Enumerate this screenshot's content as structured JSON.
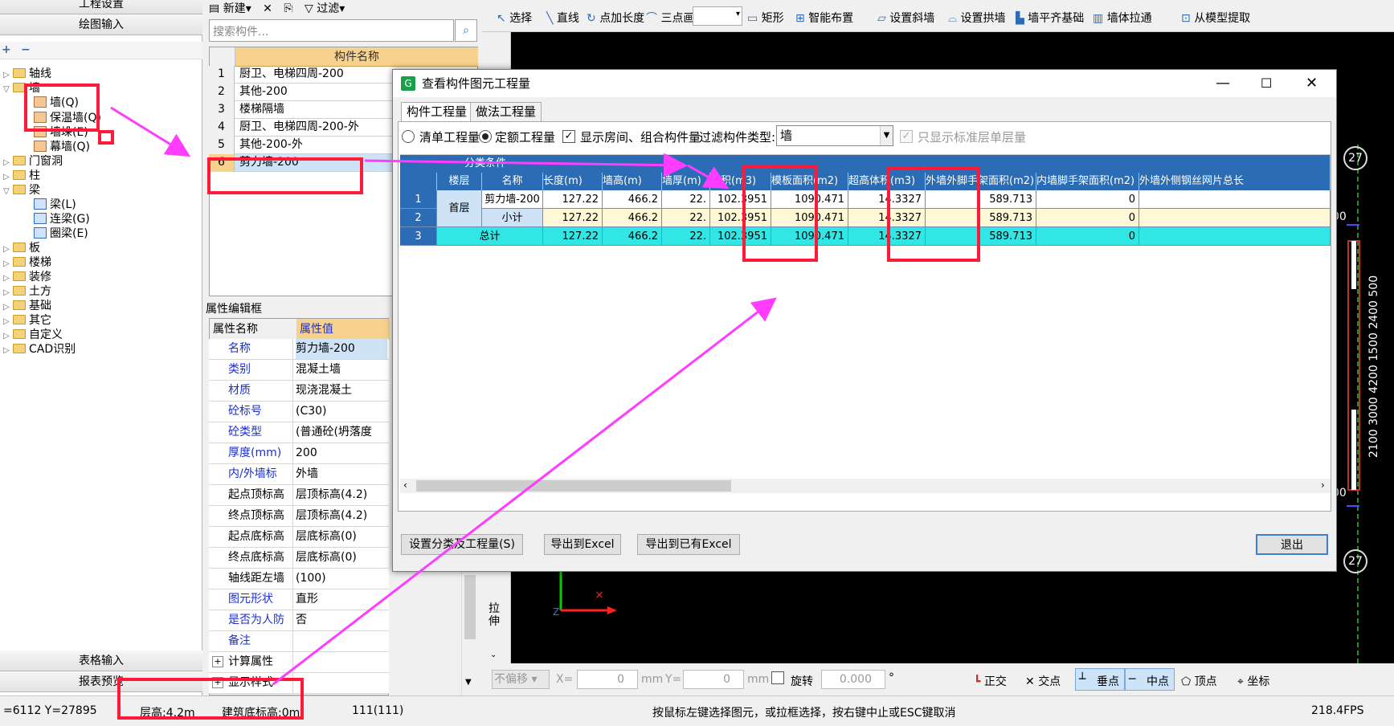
{
  "left_nav": {
    "header_project": "工程设置",
    "header_draw": "绘图输入",
    "tree": [
      {
        "label": "轴线"
      },
      {
        "label": "墙"
      },
      {
        "label": "墙(Q)"
      },
      {
        "label": "保温墙(Q)"
      },
      {
        "label": "墙垛(E)"
      },
      {
        "label": "幕墙(Q)"
      },
      {
        "label": "门窗洞"
      },
      {
        "label": "柱"
      },
      {
        "label": "梁"
      },
      {
        "label": "梁(L)"
      },
      {
        "label": "连梁(G)"
      },
      {
        "label": "圈梁(E)"
      },
      {
        "label": "板"
      },
      {
        "label": "楼梯"
      },
      {
        "label": "装修"
      },
      {
        "label": "土方"
      },
      {
        "label": "基础"
      },
      {
        "label": "其它"
      },
      {
        "label": "自定义"
      },
      {
        "label": "CAD识别"
      }
    ],
    "footer_table": "表格输入",
    "footer_report": "报表预览"
  },
  "component_panel": {
    "new_label": "新建",
    "filter_label": "过滤",
    "search_placeholder": "搜索构件...",
    "column_header": "构件名称",
    "rows": [
      {
        "num": "1",
        "name": "厨卫、电梯四周-200"
      },
      {
        "num": "2",
        "name": "其他-200"
      },
      {
        "num": "3",
        "name": "楼梯隔墙"
      },
      {
        "num": "4",
        "name": "厨卫、电梯四周-200-外"
      },
      {
        "num": "5",
        "name": "其他-200-外"
      },
      {
        "num": "6",
        "name": "剪力墙-200"
      }
    ]
  },
  "property_panel": {
    "title": "属性编辑框",
    "col_name": "属性名称",
    "col_value": "属性值",
    "rows": [
      {
        "name": "名称",
        "value": "剪力墙-200"
      },
      {
        "name": "类别",
        "value": "混凝土墙"
      },
      {
        "name": "材质",
        "value": "现浇混凝土"
      },
      {
        "name": "砼标号",
        "value": "(C30)"
      },
      {
        "name": "砼类型",
        "value": "(普通砼(坍落度"
      },
      {
        "name": "厚度(mm)",
        "value": "200"
      },
      {
        "name": "内/外墙标",
        "value": "外墙"
      },
      {
        "name": "起点顶标高",
        "value": "层顶标高(4.2)"
      },
      {
        "name": "终点顶标高",
        "value": "层顶标高(4.2)"
      },
      {
        "name": "起点底标高",
        "value": "层底标高(0)"
      },
      {
        "name": "终点底标高",
        "value": "层底标高(0)"
      },
      {
        "name": "轴线距左墙",
        "value": "(100)"
      },
      {
        "name": "图元形状",
        "value": "直形"
      },
      {
        "name": "是否为人防",
        "value": "否"
      },
      {
        "name": "备注",
        "value": ""
      },
      {
        "name": "计算属性",
        "value": ""
      },
      {
        "name": "显示样式",
        "value": ""
      }
    ]
  },
  "toolbar": {
    "items": [
      "选择",
      "直线",
      "点加长度",
      "三点画弧",
      "矩形",
      "智能布置",
      "设置斜墙",
      "设置拱墙",
      "墙平齐基础",
      "墙体拉通",
      "从模型提取"
    ]
  },
  "dialog": {
    "title": "查看构件图元工程量",
    "tabs": [
      "构件工程量",
      "做法工程量"
    ],
    "radio_list": "清单工程量",
    "radio_quota": "定额工程量",
    "check_room": "显示房间、组合构件量",
    "filter_label": "过滤构件类型:",
    "filter_value": "墙",
    "check_std": "只显示标准层单层量",
    "group_header": "分类条件",
    "headers": [
      "楼层",
      "名称",
      "长度(m)",
      "墙高(m)",
      "墙厚(m)",
      "体积(m3)",
      "模板面积(m2)",
      "超高体积(m3)",
      "外墙外脚手架面积(m2)",
      "内墙脚手架面积(m2)",
      "外墙外侧钢丝网片总长"
    ],
    "rows": [
      {
        "num": "1",
        "floor": "首层",
        "name": "剪力墙-200",
        "length": "127.22",
        "height": "466.2",
        "thick": "22.",
        "volume": "102.3951",
        "formwork": "1090.471",
        "over_vol": "14.3327",
        "ext_scaffold": "589.713",
        "int_scaffold": "0"
      },
      {
        "num": "2",
        "floor": "",
        "name": "小计",
        "length": "127.22",
        "height": "466.2",
        "thick": "22.",
        "volume": "102.3951",
        "formwork": "1090.471",
        "over_vol": "14.3327",
        "ext_scaffold": "589.713",
        "int_scaffold": "0"
      },
      {
        "num": "3",
        "floor": "总计",
        "name": "",
        "length": "127.22",
        "height": "466.2",
        "thick": "22.",
        "volume": "102.3951",
        "formwork": "1090.471",
        "over_vol": "14.3327",
        "ext_scaffold": "589.713",
        "int_scaffold": "0"
      }
    ],
    "btn_setup": "设置分类及工程量(S)",
    "btn_export": "导出到Excel",
    "btn_export_existing": "导出到已有Excel",
    "btn_exit": "退出"
  },
  "cad": {
    "axis_labels": [
      "27",
      "27",
      "00",
      "00"
    ],
    "dims": "2100 3000   4200   1500 2400 500"
  },
  "bottom_bar": {
    "no_offset": "不偏移",
    "x_label": "X=",
    "x_value": "0",
    "mm1": "mm",
    "y_label": "Y=",
    "y_value": "0",
    "mm2": "mm",
    "rotate": "旋转",
    "rotate_value": "0.000",
    "degree": "°",
    "ortho": "正交",
    "intersect": "交点",
    "perp": "垂点",
    "mid": "中点",
    "vertex": "顶点",
    "coord": "坐标",
    "stretch": "拉伸"
  },
  "status": {
    "coords": "=6112 Y=27895",
    "floor_height": "层高:4.2m",
    "base_elev": "建筑底标高:0m",
    "count": "111(111)",
    "hint": "按鼠标左键选择图元，或拉框选择，按右键中止或ESC键取消",
    "fps": "218.4FPS"
  }
}
